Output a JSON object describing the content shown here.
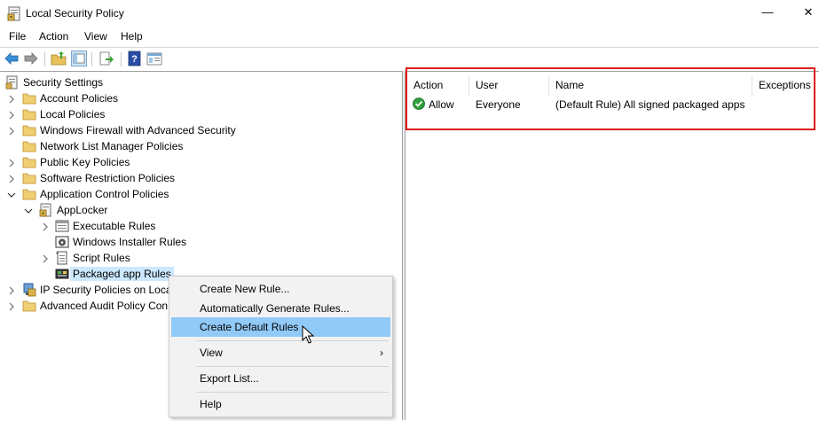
{
  "window": {
    "title": "Local Security Policy",
    "minimize_glyph": "—",
    "close_glyph": "✕"
  },
  "menubar": {
    "items": [
      "File",
      "Action",
      "View",
      "Help"
    ]
  },
  "toolbar": {
    "icons": [
      "back-arrow-icon",
      "forward-arrow-icon",
      "up-folder-icon",
      "show-hide-tree-icon",
      "export-list-icon",
      "help-icon",
      "properties-icon"
    ]
  },
  "tree": {
    "root": "Security Settings",
    "items": [
      {
        "label": "Account Policies"
      },
      {
        "label": "Local Policies"
      },
      {
        "label": "Windows Firewall with Advanced Security"
      },
      {
        "label": "Network List Manager Policies"
      },
      {
        "label": "Public Key Policies"
      },
      {
        "label": "Software Restriction Policies"
      },
      {
        "label": "Application Control Policies"
      },
      {
        "label": "AppLocker"
      },
      {
        "label": "Executable Rules"
      },
      {
        "label": "Windows Installer Rules"
      },
      {
        "label": "Script Rules"
      },
      {
        "label": "Packaged app Rules"
      },
      {
        "label": "IP Security Policies on Local"
      },
      {
        "label": "Advanced Audit Policy Con"
      }
    ]
  },
  "details": {
    "columns": [
      "Action",
      "User",
      "Name",
      "Exceptions"
    ],
    "rows": [
      {
        "action": "Allow",
        "user": "Everyone",
        "name": "(Default Rule) All signed packaged apps",
        "exceptions": ""
      }
    ]
  },
  "context_menu": {
    "items": [
      {
        "label": "Create New Rule..."
      },
      {
        "label": "Automatically Generate Rules..."
      },
      {
        "label": "Create Default Rules"
      },
      {
        "label": "View",
        "arrow": "›"
      },
      {
        "label": "Export List..."
      },
      {
        "label": "Help"
      }
    ]
  },
  "colors": {
    "highlight_box": "#e01b1b",
    "menu_hover": "#91c9f7",
    "tree_selected": "#cce8ff"
  }
}
